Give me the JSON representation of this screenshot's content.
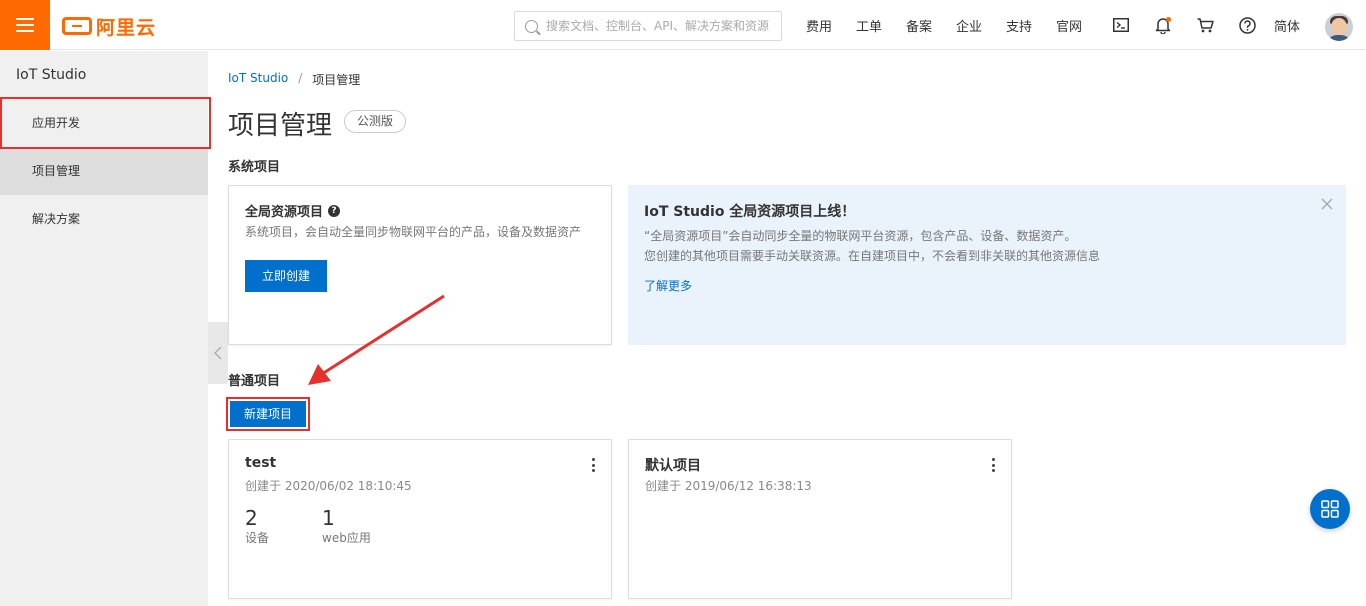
{
  "colors": {
    "brand": "#ff6a00",
    "primary": "#0070cc",
    "highlight": "#e5302d",
    "notice_bg": "#eaf2fb"
  },
  "topbar": {
    "menu_icon": "hamburger-menu-icon",
    "logo_text": "阿里云",
    "search_placeholder": "搜索文档、控制台、API、解决方案和资源",
    "links": [
      "费用",
      "工单",
      "备案",
      "企业",
      "支持",
      "官网"
    ],
    "icons": [
      "terminal-icon",
      "bell-icon",
      "cart-icon",
      "help-circle-icon"
    ],
    "lang": "简体",
    "avatar_icon": "user-avatar"
  },
  "sidebar": {
    "title": "IoT Studio",
    "items": [
      {
        "label": "应用开发",
        "active": false
      },
      {
        "label": "项目管理",
        "active": true
      },
      {
        "label": "解决方案",
        "active": false
      }
    ]
  },
  "breadcrumb": {
    "root": "IoT Studio",
    "separator": "/",
    "current": "项目管理"
  },
  "page": {
    "title": "项目管理",
    "badge": "公测版"
  },
  "system_section": {
    "title": "系统项目",
    "card": {
      "title": "全局资源项目",
      "help_icon": "question-circle-icon",
      "desc": "系统项目，会自动全量同步物联网平台的产品，设备及数据资产",
      "button": "立即创建"
    }
  },
  "notice": {
    "title": "IoT Studio 全局资源项目上线！",
    "line1": "“全局资源项目”会自动同步全量的物联网平台资源，包含产品、设备、数据资产。",
    "line2": "您创建的其他项目需要手动关联资源。在自建项目中，不会看到非关联的其他资源信息",
    "link": "了解更多",
    "close_icon": "close-icon"
  },
  "normal_section": {
    "title": "普通项目",
    "new_button": "新建项目",
    "projects": [
      {
        "name": "test",
        "created": "创建于 2020/06/02 18:10:45",
        "stats": [
          {
            "value": "2",
            "label": "设备"
          },
          {
            "value": "1",
            "label": "web应用"
          }
        ]
      },
      {
        "name": "默认项目",
        "created": "创建于 2019/06/12 16:38:13",
        "stats": []
      }
    ]
  },
  "fab_icon": "grid-apps-icon"
}
